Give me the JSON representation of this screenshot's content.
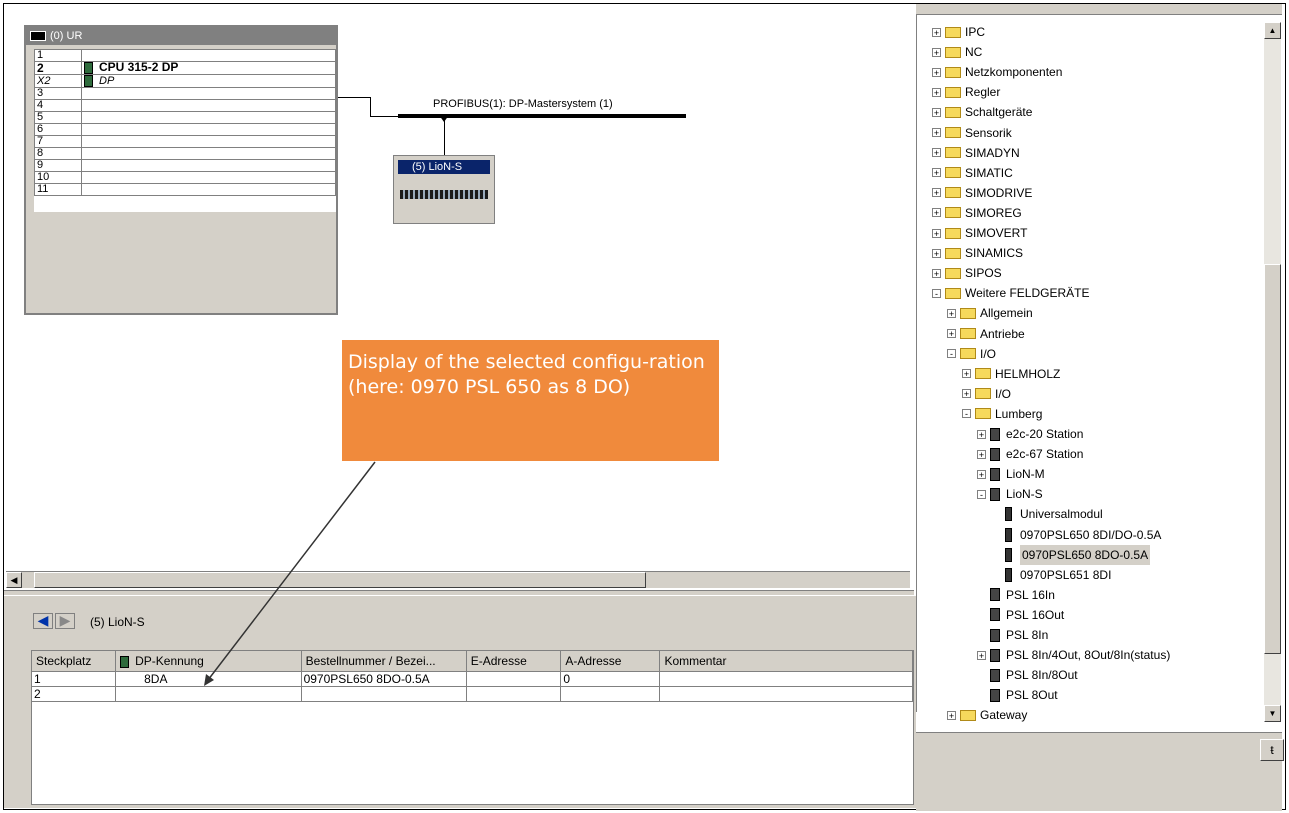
{
  "rack": {
    "title": "(0) UR",
    "slots": [
      {
        "slot": "1",
        "module": ""
      },
      {
        "slot": "2",
        "module": "CPU 315-2 DP"
      },
      {
        "slot": "X2",
        "module": "DP"
      },
      {
        "slot": "3",
        "module": ""
      },
      {
        "slot": "4",
        "module": ""
      },
      {
        "slot": "5",
        "module": ""
      },
      {
        "slot": "6",
        "module": ""
      },
      {
        "slot": "7",
        "module": ""
      },
      {
        "slot": "8",
        "module": ""
      },
      {
        "slot": "9",
        "module": ""
      },
      {
        "slot": "10",
        "module": ""
      },
      {
        "slot": "11",
        "module": ""
      }
    ]
  },
  "bus": {
    "label": "PROFIBUS(1): DP-Mastersystem (1)"
  },
  "slave": {
    "title": "(5) LioN-S"
  },
  "callout": {
    "text": "Display of the selected configu-ration (here: 0970 PSL 650 as 8 DO)"
  },
  "detail": {
    "title": "(5)   LioN-S",
    "columns": [
      "Steckplatz",
      "DP-Kennung",
      "Bestellnummer / Bezei...",
      "E-Adresse",
      "A-Adresse",
      "Kommentar"
    ],
    "rows": [
      [
        "1",
        "8DA",
        "0970PSL650 8DO-0.5A",
        "",
        "0",
        ""
      ],
      [
        "2",
        "",
        "",
        "",
        "",
        ""
      ]
    ]
  },
  "catalog": {
    "items": [
      {
        "label": "IPC",
        "kind": "folder",
        "exp": "+"
      },
      {
        "label": "NC",
        "kind": "folder",
        "exp": "+"
      },
      {
        "label": "Netzkomponenten",
        "kind": "folder",
        "exp": "+"
      },
      {
        "label": "Regler",
        "kind": "folder",
        "exp": "+"
      },
      {
        "label": "Schaltgeräte",
        "kind": "folder",
        "exp": "+"
      },
      {
        "label": "Sensorik",
        "kind": "folder",
        "exp": "+"
      },
      {
        "label": "SIMADYN",
        "kind": "folder",
        "exp": "+"
      },
      {
        "label": "SIMATIC",
        "kind": "folder",
        "exp": "+"
      },
      {
        "label": "SIMODRIVE",
        "kind": "folder",
        "exp": "+"
      },
      {
        "label": "SIMOREG",
        "kind": "folder",
        "exp": "+"
      },
      {
        "label": "SIMOVERT",
        "kind": "folder",
        "exp": "+"
      },
      {
        "label": "SINAMICS",
        "kind": "folder",
        "exp": "+"
      },
      {
        "label": "SIPOS",
        "kind": "folder",
        "exp": "+"
      },
      {
        "label": "Weitere FELDGERÄTE",
        "kind": "folder",
        "exp": "-"
      },
      {
        "label": "Allgemein",
        "kind": "folder",
        "exp": "+"
      },
      {
        "label": "Antriebe",
        "kind": "folder",
        "exp": "+"
      },
      {
        "label": "I/O",
        "kind": "folder",
        "exp": "-"
      },
      {
        "label": "HELMHOLZ",
        "kind": "folder",
        "exp": "+"
      },
      {
        "label": "I/O",
        "kind": "folder",
        "exp": "+"
      },
      {
        "label": "Lumberg",
        "kind": "folder",
        "exp": "-"
      },
      {
        "label": "e2c-20 Station",
        "kind": "device",
        "exp": "+"
      },
      {
        "label": "e2c-67 Station",
        "kind": "device",
        "exp": "+"
      },
      {
        "label": "LioN-M",
        "kind": "device",
        "exp": "+"
      },
      {
        "label": "LioN-S",
        "kind": "device",
        "exp": "-"
      },
      {
        "label": "Universalmodul",
        "kind": "module",
        "exp": ""
      },
      {
        "label": "0970PSL650 8DI/DO-0.5A",
        "kind": "module",
        "exp": ""
      },
      {
        "label": "0970PSL650 8DO-0.5A",
        "kind": "module",
        "exp": "",
        "selected": true
      },
      {
        "label": "0970PSL651 8DI",
        "kind": "module",
        "exp": ""
      },
      {
        "label": "PSL 16In",
        "kind": "device",
        "exp": ""
      },
      {
        "label": "PSL 16Out",
        "kind": "device",
        "exp": ""
      },
      {
        "label": "PSL 8In",
        "kind": "device",
        "exp": ""
      },
      {
        "label": "PSL 8In/4Out, 8Out/8In(status)",
        "kind": "device",
        "exp": "+"
      },
      {
        "label": "PSL 8In/8Out",
        "kind": "device",
        "exp": ""
      },
      {
        "label": "PSL 8Out",
        "kind": "device",
        "exp": ""
      },
      {
        "label": "Gateway",
        "kind": "folder",
        "exp": "+"
      }
    ]
  },
  "colors": {
    "callout": "#f08a3c",
    "window_bg": "#d4d0c8",
    "selection": "#0a246a"
  }
}
